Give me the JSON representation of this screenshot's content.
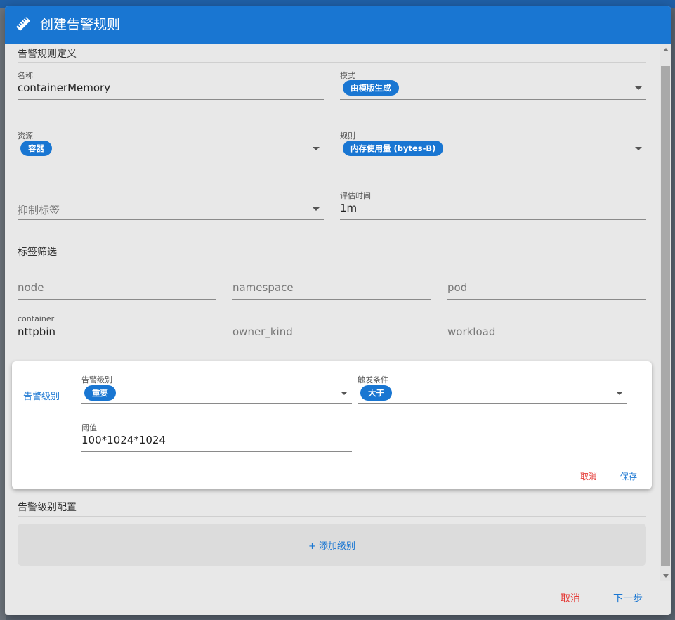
{
  "dialog": {
    "title": "创建告警规则",
    "title_icon": "ruler-icon",
    "accent_color": "#1976d2",
    "danger_color": "#e53935"
  },
  "definition": {
    "section_title": "告警规则定义",
    "name_label": "名称",
    "name_value": "containerMemory",
    "mode_label": "模式",
    "mode_value": "由模版生成",
    "resource_label": "资源",
    "resource_value": "容器",
    "rule_label": "规则",
    "rule_value": "内存使用量 (bytes-B)",
    "suppress_placeholder": "抑制标签",
    "eval_label": "评估时间",
    "eval_value": "1m"
  },
  "filters": {
    "section_title": "标签筛选",
    "node_placeholder": "node",
    "namespace_placeholder": "namespace",
    "pod_placeholder": "pod",
    "container_label": "container",
    "container_value": "nttpbin",
    "owner_kind_placeholder": "owner_kind",
    "workload_placeholder": "workload"
  },
  "level_card": {
    "label": "告警级别",
    "level_label": "告警级别",
    "level_value": "重要",
    "condition_label": "触发条件",
    "condition_value": "大于",
    "threshold_label": "阈值",
    "threshold_value": "100*1024*1024",
    "cancel": "取消",
    "save": "保存"
  },
  "level_config": {
    "section_title": "告警级别配置",
    "add_label": "+ 添加级别"
  },
  "footer": {
    "cancel": "取消",
    "next": "下一步"
  }
}
